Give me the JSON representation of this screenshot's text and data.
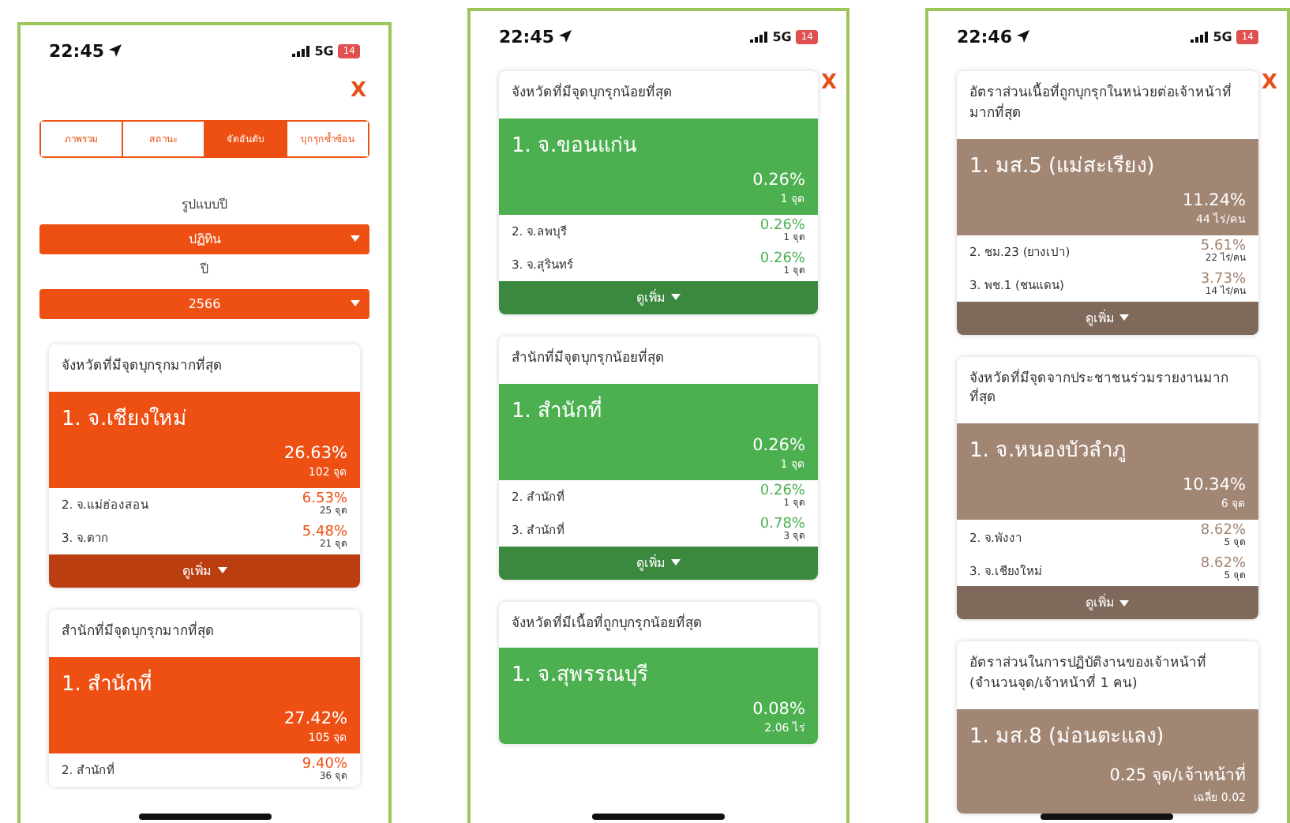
{
  "phones": [
    {
      "time": "22:45",
      "network": "5G",
      "battery": "14",
      "close": "X",
      "tabs": [
        {
          "label": "ภาพรวม",
          "selected": false
        },
        {
          "label": "สถานะ",
          "selected": false
        },
        {
          "label": "จัดอันดับ",
          "selected": true
        },
        {
          "label": "บุกรุกซ้ำซ้อน",
          "selected": false
        }
      ],
      "filters": [
        {
          "label": "รูปแบบปี",
          "value": "ปฏิทิน"
        },
        {
          "label": "ปี",
          "value": "2566"
        }
      ],
      "cards": [
        {
          "title": "จังหวัดที่มีจุดบุกรุกมากที่สุด",
          "color": "#ee5014",
          "top": {
            "name": "1. จ.เชียงใหม่",
            "value": "26.63%",
            "unit": "102 จุด"
          },
          "rows": [
            {
              "name": "2. จ.แม่ฮ่องสอน",
              "value": "6.53%",
              "unit": "25 จุด"
            },
            {
              "name": "3. จ.ตาก",
              "value": "5.48%",
              "unit": "21 จุด"
            }
          ],
          "more": "ดูเพิ่ม"
        },
        {
          "title": "สำนักที่มีจุดบุกรุกมากที่สุด",
          "color": "#ee5014",
          "top": {
            "name": "1. สำนักที่",
            "value": "27.42%",
            "unit": "105 จุด"
          },
          "rows": [
            {
              "name": "2. สำนักที่",
              "value": "9.40%",
              "unit": "36 จุด"
            }
          ]
        }
      ]
    },
    {
      "time": "22:45",
      "network": "5G",
      "battery": "14",
      "close": "X",
      "cards": [
        {
          "title": "จังหวัดที่มีจุดบุกรุกน้อยที่สุด",
          "color": "#4caf50",
          "top": {
            "name": "1. จ.ขอนแก่น",
            "value": "0.26%",
            "unit": "1 จุด"
          },
          "rows": [
            {
              "name": "2. จ.ลพบุรี",
              "value": "0.26%",
              "unit": "1 จุด"
            },
            {
              "name": "3. จ.สุรินทร์",
              "value": "0.26%",
              "unit": "1 จุด"
            }
          ],
          "more": "ดูเพิ่ม"
        },
        {
          "title": "สำนักที่มีจุดบุกรุกน้อยที่สุด",
          "color": "#4caf50",
          "top": {
            "name": "1. สำนักที่",
            "value": "0.26%",
            "unit": "1 จุด"
          },
          "rows": [
            {
              "name": "2. สำนักที่",
              "value": "0.26%",
              "unit": "1 จุด"
            },
            {
              "name": "3. สำนักที่",
              "value": "0.78%",
              "unit": "3 จุด"
            }
          ],
          "more": "ดูเพิ่ม"
        },
        {
          "title": "จังหวัดที่มีเนื้อที่ถูกบุกรุกน้อยที่สุด",
          "color": "#4caf50",
          "top": {
            "name": "1. จ.สุพรรณบุรี",
            "value": "0.08%",
            "unit": "2.06 ไร่"
          }
        }
      ]
    },
    {
      "time": "22:46",
      "network": "5G",
      "battery": "14",
      "close": "X",
      "cards": [
        {
          "title": "อัตราส่วนเนื้อที่ถูกบุกรุกในหน่วยต่อเจ้าหน้าที่มากที่สุด",
          "color": "#a28674",
          "top": {
            "name": "1. มส.5 (แม่สะเรียง)",
            "value": "11.24%",
            "unit": "44 ไร่/คน"
          },
          "rows": [
            {
              "name": "2. ชม.23 (ยางเปา)",
              "value": "5.61%",
              "unit": "22 ไร่/คน"
            },
            {
              "name": "3. พช.1 (ชนแดน)",
              "value": "3.73%",
              "unit": "14 ไร่/คน"
            }
          ],
          "more": "ดูเพิ่ม"
        },
        {
          "title": "จังหวัดที่มีจุดจากประชาชนร่วมรายงานมากที่สุด",
          "color": "#a28674",
          "top": {
            "name": "1. จ.หนองบัวลำภู",
            "value": "10.34%",
            "unit": "6 จุด"
          },
          "rows": [
            {
              "name": "2. จ.พังงา",
              "value": "8.62%",
              "unit": "5 จุด"
            },
            {
              "name": "3. จ.เชียงใหม่",
              "value": "8.62%",
              "unit": "5 จุด"
            }
          ],
          "more": "ดูเพิ่ม"
        },
        {
          "title": "อัตราส่วนในการปฏิบัติงานของเจ้าหน้าที่ (จำนวนจุด/เจ้าหน้าที่ 1 คน)",
          "color": "#a28674",
          "top": {
            "name": "1. มส.8 (ม่อนตะแลง)",
            "value": "0.25 จุด/เจ้าหน้าที่",
            "unit": "เฉลี่ย 0.02"
          }
        }
      ]
    }
  ]
}
